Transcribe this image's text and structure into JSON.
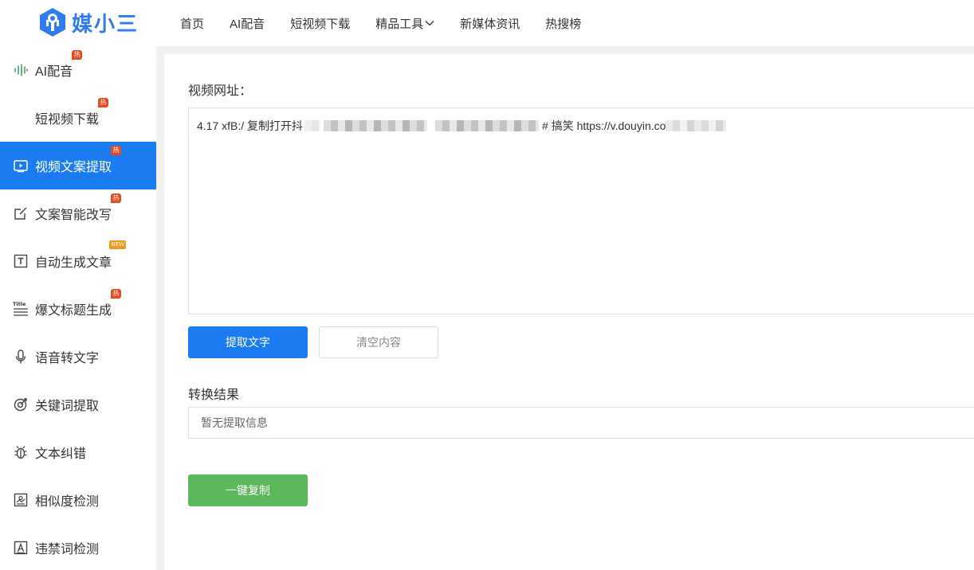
{
  "brand": {
    "name": "媒小三",
    "color": "#2f7bf0"
  },
  "nav": {
    "items": [
      {
        "label": "首页"
      },
      {
        "label": "AI配音"
      },
      {
        "label": "短视频下载"
      },
      {
        "label": "精品工具",
        "has_dropdown": true
      },
      {
        "label": "新媒体资讯"
      },
      {
        "label": "热搜榜"
      }
    ]
  },
  "sidebar": {
    "active_index": 2,
    "accent": "#1a7cf0",
    "items": [
      {
        "label": "AI配音",
        "icon": "waveform-icon",
        "badge": "热"
      },
      {
        "label": "短视频下载",
        "icon": "",
        "badge": "热"
      },
      {
        "label": "视频文案提取",
        "icon": "video-screen-icon",
        "badge": "热"
      },
      {
        "label": "文案智能改写",
        "icon": "edit-icon",
        "badge": "热"
      },
      {
        "label": "自动生成文章",
        "icon": "text-t-icon",
        "badge": "NEW"
      },
      {
        "label": "爆文标题生成",
        "icon": "title-icon",
        "badge": "热"
      },
      {
        "label": "语音转文字",
        "icon": "microphone-icon",
        "badge": ""
      },
      {
        "label": "关键词提取",
        "icon": "target-icon",
        "badge": ""
      },
      {
        "label": "文本纠错",
        "icon": "bug-icon",
        "badge": ""
      },
      {
        "label": "相似度检测",
        "icon": "image-doc-icon",
        "badge": ""
      },
      {
        "label": "违禁词检测",
        "icon": "letter-a-icon",
        "badge": ""
      }
    ]
  },
  "main": {
    "url_label": "视频网址：",
    "url_value_prefix": "4.17 xfB:/ 复制打开抖",
    "url_value_middle": "# 搞笑 https://v.douyin.co",
    "extract_button": "提取文字",
    "clear_button": "清空内容",
    "result_label": "转换结果",
    "result_placeholder": "暂无提取信息",
    "copy_button": "一键复制",
    "colors": {
      "primary": "#1a7cf0",
      "copy": "#5cb85c"
    }
  }
}
